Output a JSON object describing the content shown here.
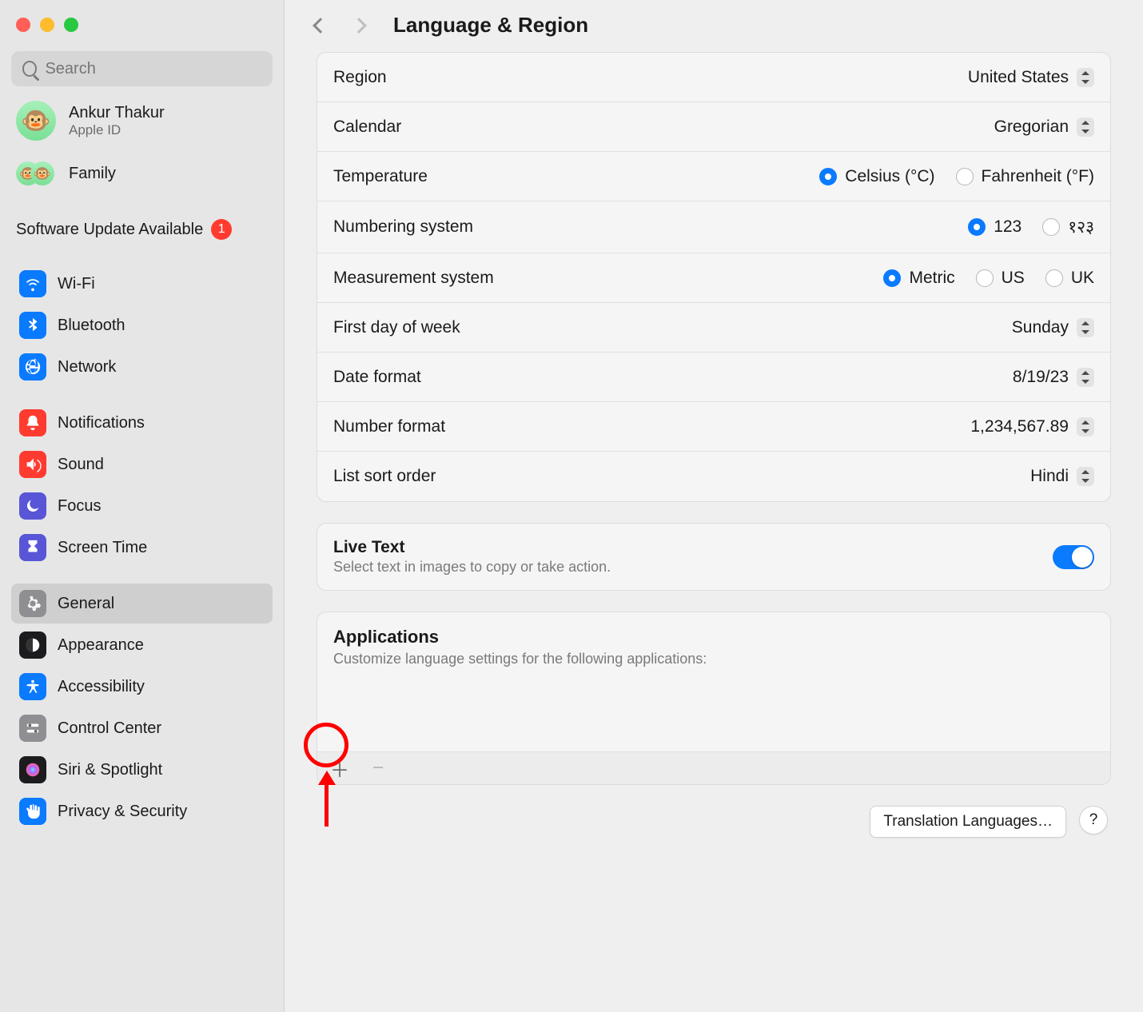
{
  "window": {
    "title": "Language & Region"
  },
  "search": {
    "placeholder": "Search"
  },
  "user": {
    "name": "Ankur Thakur",
    "sub": "Apple ID",
    "emoji": "🐵"
  },
  "family": {
    "label": "Family"
  },
  "update": {
    "label": "Software Update Available",
    "count": "1"
  },
  "sidebar": {
    "group1": [
      {
        "label": "Wi-Fi",
        "color": "#0a7aff",
        "svgKey": "wifi"
      },
      {
        "label": "Bluetooth",
        "color": "#0a7aff",
        "svgKey": "bluetooth"
      },
      {
        "label": "Network",
        "color": "#0a7aff",
        "svgKey": "globe"
      }
    ],
    "group2": [
      {
        "label": "Notifications",
        "color": "#ff3b30",
        "svgKey": "bell"
      },
      {
        "label": "Sound",
        "color": "#ff3b30",
        "svgKey": "sound"
      },
      {
        "label": "Focus",
        "color": "#5856d6",
        "svgKey": "moon"
      },
      {
        "label": "Screen Time",
        "color": "#5856d6",
        "svgKey": "hourglass"
      }
    ],
    "group3": [
      {
        "label": "General",
        "color": "#8e8e93",
        "svgKey": "gear",
        "selected": true
      },
      {
        "label": "Appearance",
        "color": "#1c1c1e",
        "svgKey": "appearance"
      },
      {
        "label": "Accessibility",
        "color": "#0a7aff",
        "svgKey": "accessibility"
      },
      {
        "label": "Control Center",
        "color": "#8e8e93",
        "svgKey": "control"
      },
      {
        "label": "Siri & Spotlight",
        "color": "#1c1c1e",
        "svgKey": "siri"
      },
      {
        "label": "Privacy & Security",
        "color": "#0a7aff",
        "svgKey": "hand"
      }
    ]
  },
  "settings": {
    "region": {
      "label": "Region",
      "value": "United States"
    },
    "calendar": {
      "label": "Calendar",
      "value": "Gregorian"
    },
    "temperature": {
      "label": "Temperature",
      "options": [
        "Celsius (°C)",
        "Fahrenheit (°F)"
      ],
      "selected": 0
    },
    "numbering": {
      "label": "Numbering system",
      "options": [
        "123",
        "१२३"
      ],
      "selected": 0
    },
    "measurement": {
      "label": "Measurement system",
      "options": [
        "Metric",
        "US",
        "UK"
      ],
      "selected": 0
    },
    "firstDay": {
      "label": "First day of week",
      "value": "Sunday"
    },
    "dateFormat": {
      "label": "Date format",
      "value": "8/19/23"
    },
    "numberFormat": {
      "label": "Number format",
      "value": "1,234,567.89"
    },
    "listSort": {
      "label": "List sort order",
      "value": "Hindi"
    }
  },
  "liveText": {
    "title": "Live Text",
    "sub": "Select text in images to copy or take action.",
    "on": true
  },
  "applications": {
    "title": "Applications",
    "sub": "Customize language settings for the following applications:"
  },
  "footer": {
    "translation": "Translation Languages…",
    "help": "?"
  }
}
